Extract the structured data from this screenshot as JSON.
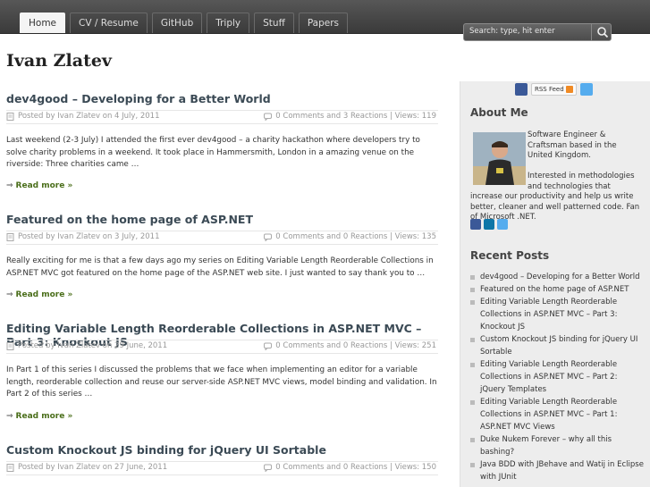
{
  "nav": {
    "tabs": [
      {
        "label": "Home",
        "active": true
      },
      {
        "label": "CV / Resume",
        "active": false
      },
      {
        "label": "GitHub",
        "active": false
      },
      {
        "label": "Triply",
        "active": false
      },
      {
        "label": "Stuff",
        "active": false
      },
      {
        "label": "Papers",
        "active": false
      }
    ]
  },
  "search": {
    "placeholder": "Search: type, hit enter"
  },
  "site": {
    "title": "Ivan Zlatev"
  },
  "posts": [
    {
      "title": "dev4good – Developing for a Better World",
      "posted": "Posted by Ivan Zlatev on 4 July, 2011",
      "stats": "0 Comments and 3 Reactions | Views: 119",
      "excerpt": "Last weekend (2-3 July) I attended the first ever dev4good – a charity hackathon where developers try to solve charity problems in a weekend. It took place in Hammersmith, London in a amazing venue on the riverside: Three charities came …",
      "readmore": "Read more »"
    },
    {
      "title": "Featured on the home page of ASP.NET",
      "posted": "Posted by Ivan Zlatev on 3 July, 2011",
      "stats": "0 Comments and 0 Reactions | Views: 135",
      "excerpt": "Really exciting for me is that a few days ago my series on Editing Variable Length Reorderable Collections in ASP.NET MVC got featured on the home page of the ASP.NET web site. I just wanted to say thank you to …",
      "readmore": "Read more »"
    },
    {
      "title": "Editing Variable Length Reorderable Collections in ASP.NET MVC – Part 3: Knockout JS",
      "posted": "Posted by Ivan Zlatev on 29 June, 2011",
      "stats": "0 Comments and 0 Reactions | Views: 251",
      "excerpt": "In Part 1 of this series I discussed the problems that we face when implementing an editor for a variable length, reorderable collection and reuse our server-side ASP.NET MVC views, model binding and validation. In Part 2 of this series …",
      "readmore": "Read more »"
    },
    {
      "title": "Custom Knockout JS binding for jQuery UI Sortable",
      "posted": "Posted by Ivan Zlatev on 27 June, 2011",
      "stats": "0 Comments and 0 Reactions | Views: 150"
    }
  ],
  "sidebar": {
    "rss_label": "RSS Feed",
    "about_title": "About Me",
    "about_text": "Software Engineer & Craftsman based in the United Kingdom.",
    "about_text2": "Interested in methodologies and technologies that increase our productivity and help us write better, cleaner and well patterned code. Fan of Microsoft .NET.",
    "recent_title": "Recent Posts",
    "recent": [
      "dev4good – Developing for a Better World",
      "Featured on the home page of ASP.NET",
      "Editing Variable Length Reorderable Collections in ASP.NET MVC – Part 3: Knockout JS",
      "Custom Knockout JS binding for jQuery UI Sortable",
      "Editing Variable Length Reorderable Collections in ASP.NET MVC – Part 2: jQuery Templates",
      "Editing Variable Length Reorderable Collections in ASP.NET MVC – Part 1: ASP.NET MVC Views",
      "Duke Nukem Forever – why all this bashing?",
      "Java BDD with JBehave and Watij in Eclipse with JUnit"
    ]
  },
  "colors": {
    "accent_link": "#4a6e1a",
    "topbar": "#444444",
    "sidebar_bg": "#ededed"
  }
}
